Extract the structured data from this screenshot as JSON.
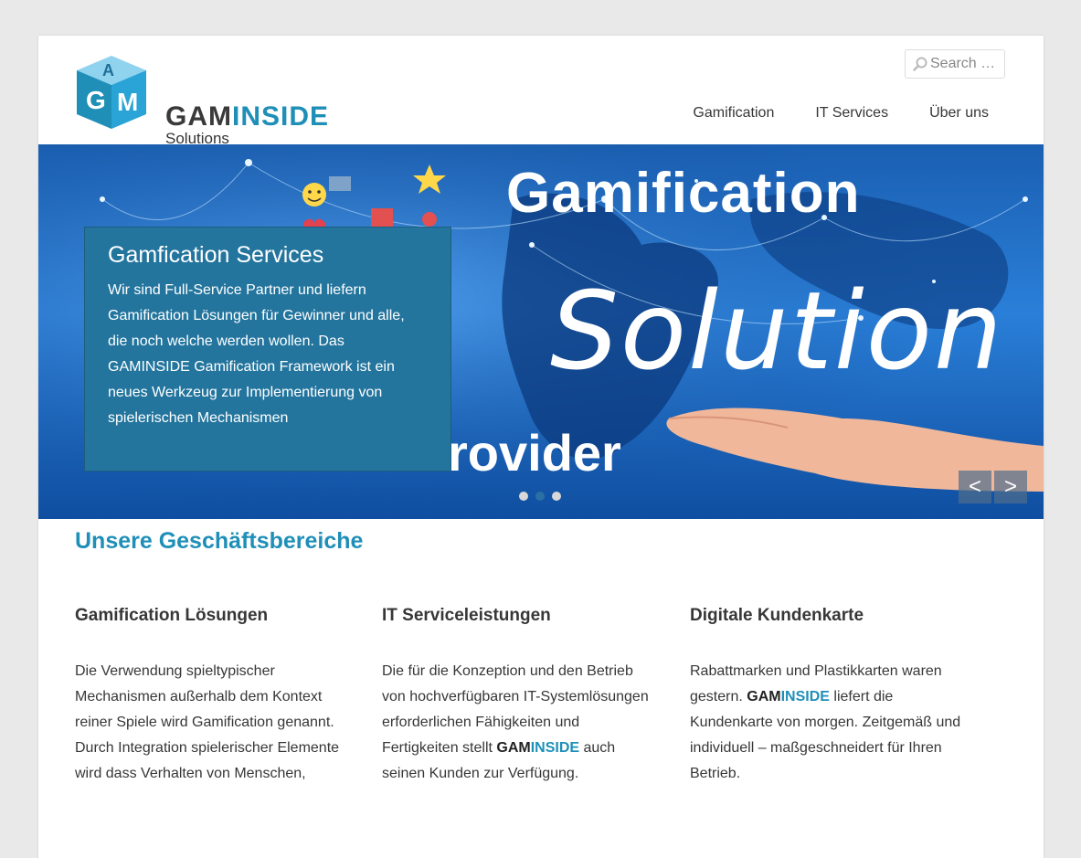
{
  "header": {
    "logo_mark": "GAM",
    "logo_word_a": "GAM",
    "logo_word_b": "INSIDE",
    "logo_sub": "Solutions",
    "search_placeholder": "Search …",
    "nav": [
      "Gamification",
      "IT Services",
      "Über uns"
    ]
  },
  "hero": {
    "image_title": "Gamification",
    "image_solution": "Solution",
    "image_provider": "rovider",
    "caption_title": "Gamfication Services",
    "caption_text": "Wir sind Full-Service Partner und liefern Gamification Lösungen für Gewinner und alle, die noch welche werden wollen. Das GAMINSIDE Gamification Framework ist ein neues Werkzeug zur Implementierung von spielerischen Mechanismen",
    "dots_count": 3,
    "active_dot": 2,
    "prev_label": "<",
    "next_label": ">"
  },
  "section": {
    "title": "Unsere Geschäftsbereiche",
    "columns": [
      {
        "title": "Gamification Lösungen",
        "text": "Die Verwendung spieltypischer Mechanismen außerhalb dem Kontext reiner Spiele wird Gamification genannt. Durch Integration spielerischer Elemente wird dass Verhalten von Menschen,"
      },
      {
        "title": "IT Serviceleistungen",
        "text_before": "Die für die Konzeption und den Betrieb von hochverfügbaren IT-Systemlösungen erforderlichen Fähigkeiten und Fertigkeiten stellt ",
        "brand_a": "GAM",
        "brand_b": "INSIDE",
        "text_after": " auch seinen Kunden zur Verfügung."
      },
      {
        "title": "Digitale Kundenkarte",
        "text_before": "Rabattmarken und  Plastikkarten waren gestern. ",
        "brand_a": "GAM",
        "brand_b": "INSIDE",
        "text_after": " liefert die Kundenkarte von morgen. Zeitgemäß und individuell – maßgeschneidert für Ihren Betrieb."
      }
    ]
  },
  "colors": {
    "accent": "#1f8fb8",
    "caption_bg": "#23759e",
    "page_bg": "#e9e9e9"
  }
}
